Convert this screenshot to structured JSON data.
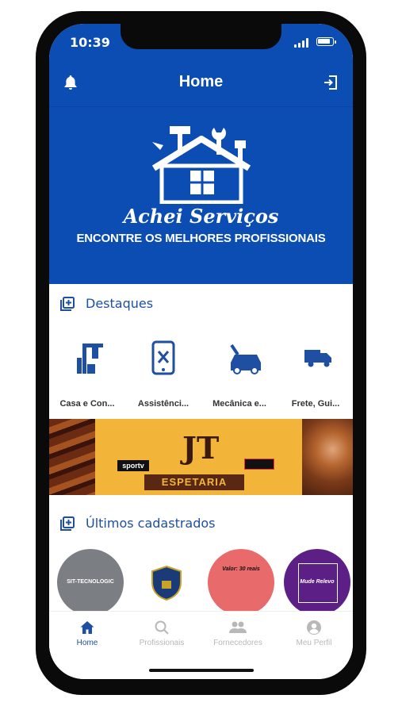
{
  "status": {
    "time": "10:39"
  },
  "header": {
    "title": "Home"
  },
  "hero": {
    "brand": "Achei Serviços",
    "tagline": "ENCONTRE OS MELHORES PROFISSIONAIS"
  },
  "featured": {
    "title": "Destaques",
    "categories": [
      {
        "label": "Casa e Con...",
        "icon": "construction-icon"
      },
      {
        "label": "Assistênci...",
        "icon": "phone-repair-icon"
      },
      {
        "label": "Mecânica e...",
        "icon": "car-repair-icon"
      },
      {
        "label": "Frete, Gui...",
        "icon": "truck-icon"
      }
    ]
  },
  "banner": {
    "logo_text": "JT",
    "ribbon": "ESPETARIA",
    "tv_text": "sportv"
  },
  "latest": {
    "title": "Últimos cadastrados",
    "items": [
      {
        "name": "SIT-TECNOLOGIC"
      },
      {
        "name": "security-shield-logo"
      },
      {
        "name": "Valor: 30 reais"
      },
      {
        "name": "Mude Relevo"
      }
    ]
  },
  "tabs": [
    {
      "label": "Home",
      "icon": "home-icon",
      "active": true
    },
    {
      "label": "Profissionais",
      "icon": "search-icon",
      "active": false
    },
    {
      "label": "Fornecedores",
      "icon": "users-icon",
      "active": false
    },
    {
      "label": "Meu Perfil",
      "icon": "user-circle-icon",
      "active": false
    }
  ],
  "colors": {
    "primary": "#0b4db3",
    "accent": "#1e4fa3",
    "inactive": "#b8b8b8"
  }
}
